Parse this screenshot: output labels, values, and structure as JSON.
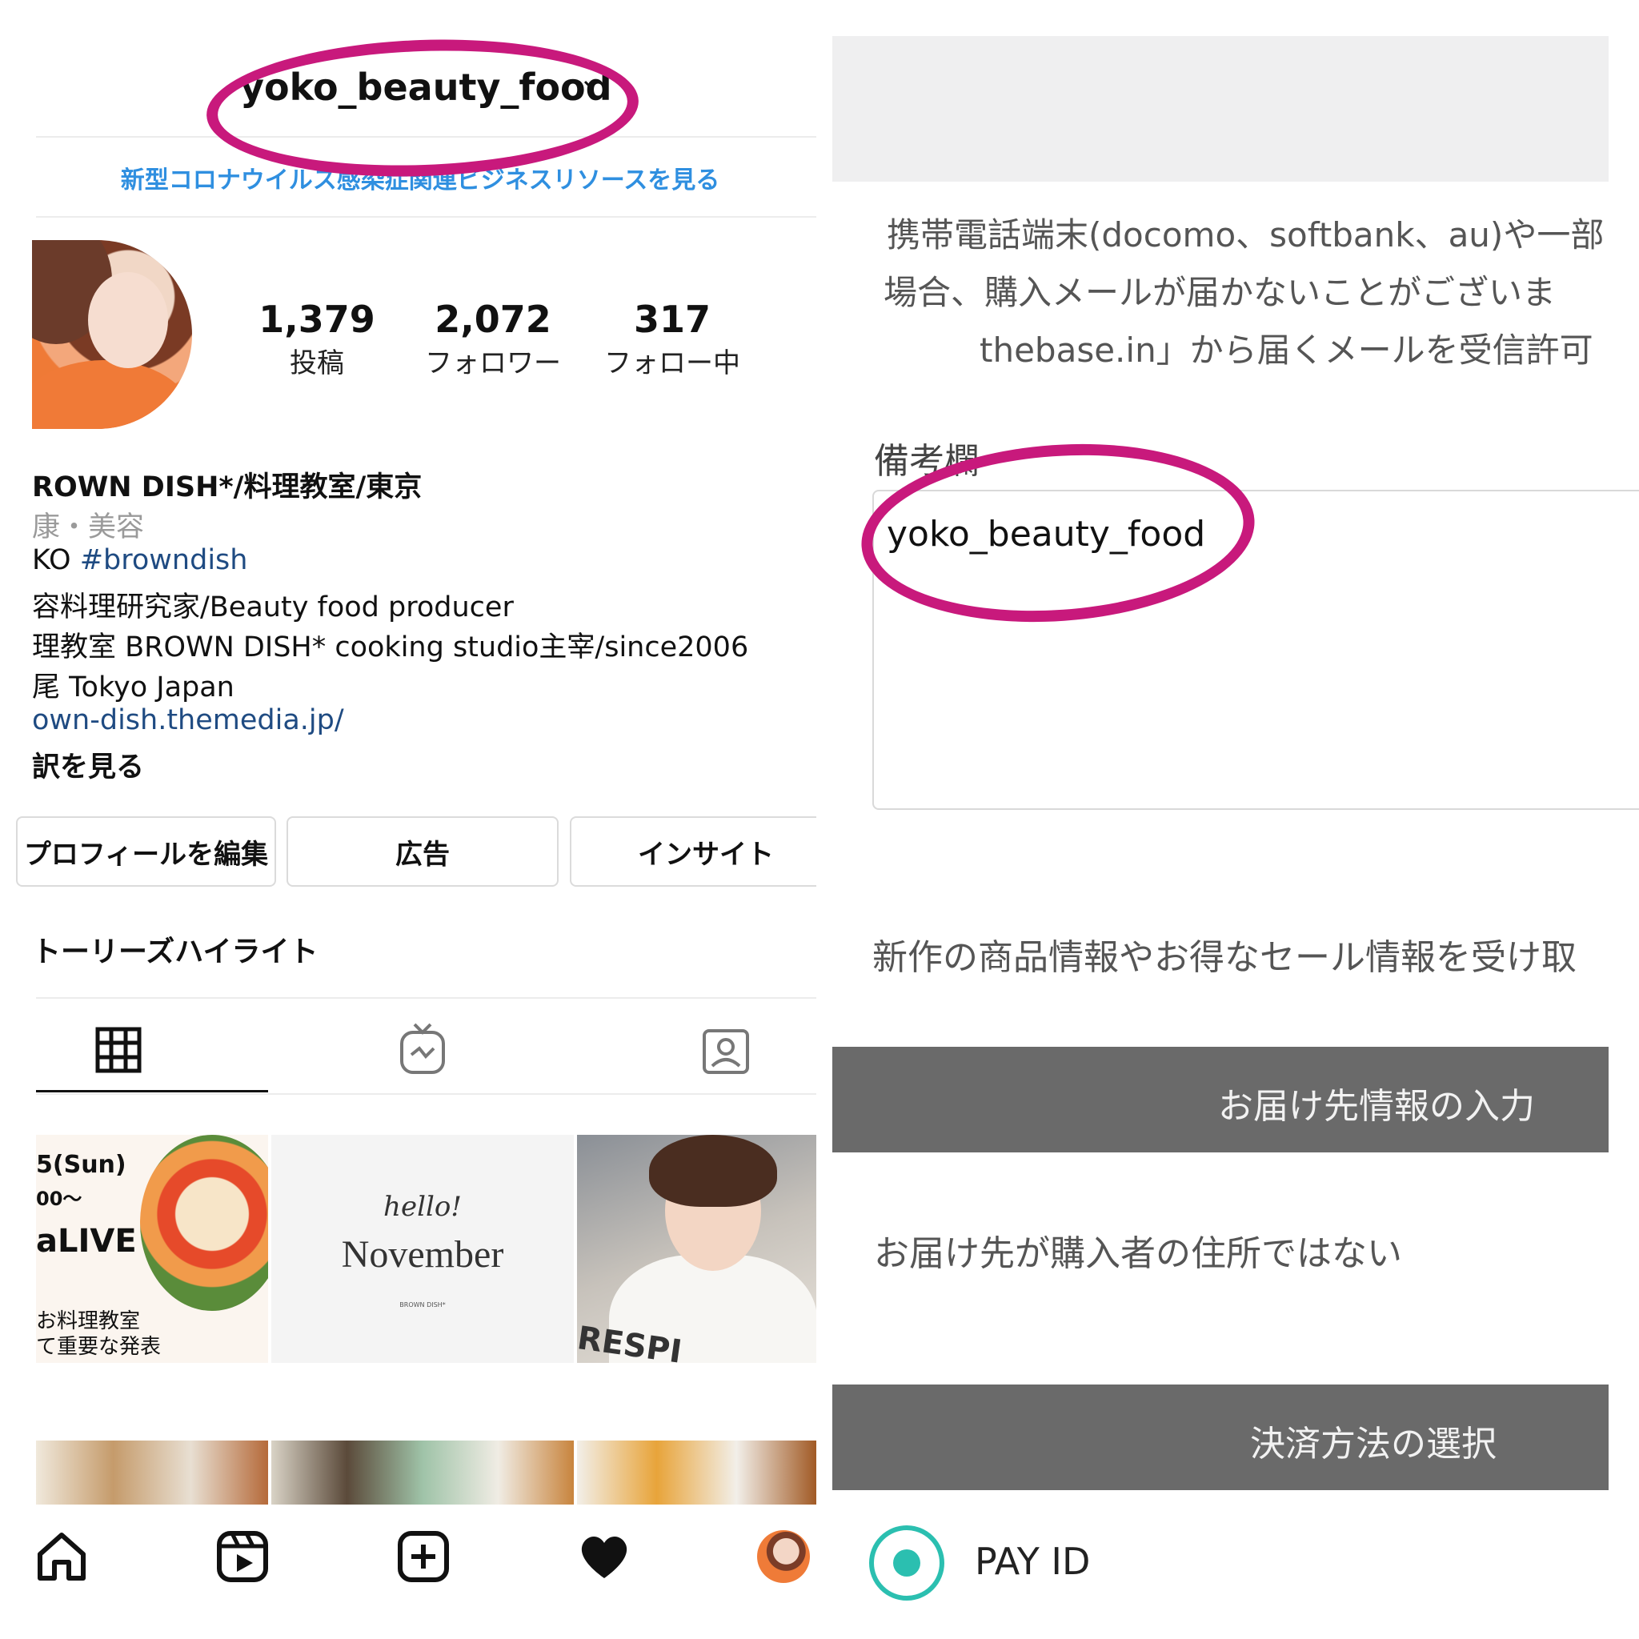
{
  "instagram": {
    "username": "yoko_beauty_food",
    "covid_link": "新型コロナウイルス感染症関連ビジネスリソースを見る",
    "stats": [
      {
        "value": "1,379",
        "label": "投稿"
      },
      {
        "value": "2,072",
        "label": "フォロワー"
      },
      {
        "value": "317",
        "label": "フォロー中"
      }
    ],
    "bio": {
      "name": "ROWN DISH*/料理教室/東京",
      "category": "康・美容",
      "line1_prefix": "KO ",
      "line1_tag": "#browndish",
      "line2": "容料理研究家/Beauty food producer",
      "line3": "理教室 BROWN DISH* cooking studio主宰/since2006",
      "line4": "尾 Tokyo Japan",
      "link": "own-dish.themedia.jp/",
      "translate": "訳を見る"
    },
    "buttons": [
      "プロフィールを編集",
      "広告",
      "インサイト"
    ],
    "highlights": "トーリーズハイライト",
    "tiles": {
      "t1_date": "5(Sun)",
      "t1_time": "00〜",
      "t1_title": "aLIVE",
      "t1_line1": "お料理教室",
      "t1_line2": "て重要な発表",
      "t2_hello": "hello!",
      "t2_month": "November",
      "t2_brand": "BROWN DISH*",
      "t3_text": "RESPI"
    },
    "nav": [
      "home-icon",
      "reels-icon",
      "new-post-icon",
      "activity-heart-icon",
      "profile-avatar"
    ]
  },
  "checkout": {
    "notice_line1": "携帯電話端末(docomo、softbank、au)や一部",
    "notice_line2": "場合、購入メールが届かないことがございま",
    "notice_line3": "thebase.in」から届くメールを受信許可",
    "remarks_label": "備考欄",
    "remarks_value": "yoko_beauty_food",
    "newsletter_text": "新作の商品情報やお得なセール情報を受け取",
    "section_delivery": "お届け先情報の入力",
    "delivery_option": "お届け先が購入者の住所ではない",
    "section_payment": "決済方法の選択",
    "payment_option": "PAY ID"
  },
  "colors": {
    "highlight_circle": "#c8197c",
    "ig_link_blue": "#2f8fe0",
    "section_bar": "#6a6a6a",
    "radio_teal": "#2bbfb0"
  }
}
